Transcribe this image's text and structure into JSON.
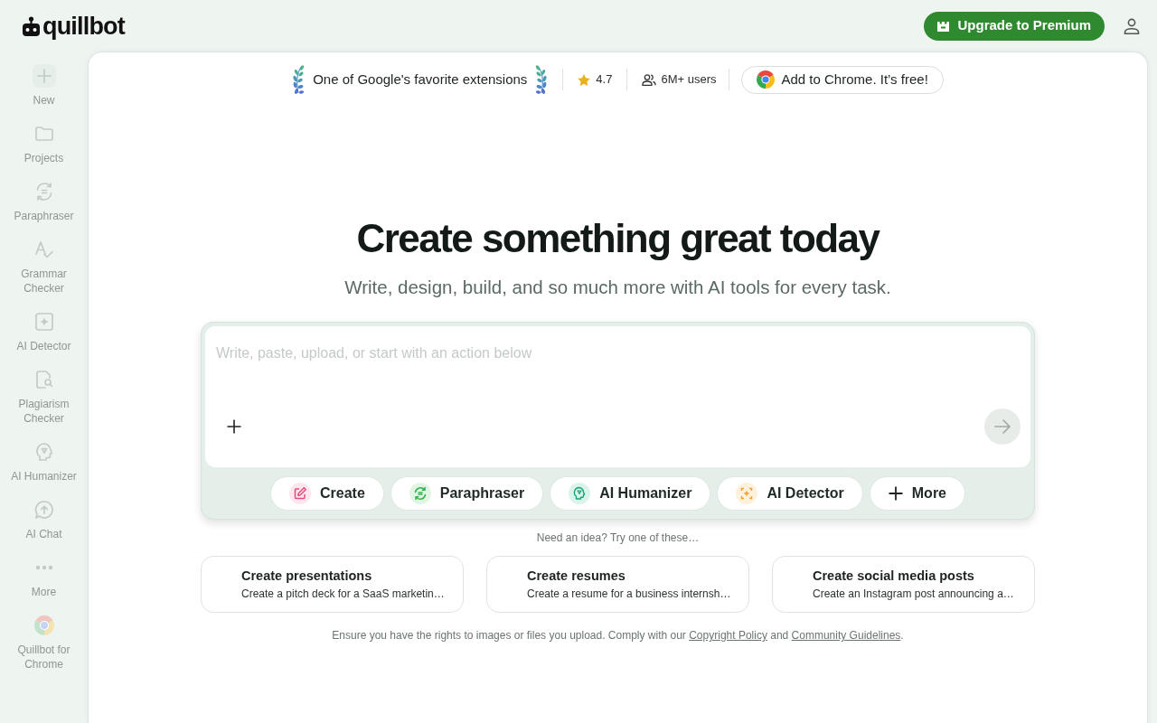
{
  "logo": {
    "text": "quillbot"
  },
  "header": {
    "upgrade_button": {
      "label": "Upgrade to Premium"
    }
  },
  "sidebar": {
    "items": [
      {
        "kind": "new",
        "label": "New"
      },
      {
        "kind": "projects",
        "label": "Projects"
      },
      {
        "kind": "paraphraser",
        "label": "Paraphraser"
      },
      {
        "kind": "grammar",
        "label": "Grammar Checker"
      },
      {
        "kind": "detector",
        "label": "AI Detector"
      },
      {
        "kind": "plagiarism",
        "label": "Plagiarism Checker"
      },
      {
        "kind": "humanizer",
        "label": "AI Humanizer"
      },
      {
        "kind": "chat",
        "label": "AI Chat"
      },
      {
        "kind": "more",
        "label": "More"
      },
      {
        "kind": "chrome",
        "label": "Quillbot for Chrome"
      }
    ]
  },
  "banner": {
    "award": "One of Google's favorite extensions",
    "rating": "4.7",
    "users": "6M+ users",
    "chrome_button": "Add to Chrome. It’s free!"
  },
  "hero": {
    "title": "Create something great today",
    "subtitle": "Write, design, build, and so much more with AI tools for every task."
  },
  "composer": {
    "placeholder": "Write, paste, upload, or start with an action below",
    "actions": [
      {
        "kind": "create",
        "label": "Create"
      },
      {
        "kind": "paraphraser",
        "label": "Paraphraser"
      },
      {
        "kind": "humanizer",
        "label": "AI Humanizer"
      },
      {
        "kind": "detector",
        "label": "AI Detector"
      },
      {
        "kind": "more",
        "label": "More"
      }
    ]
  },
  "suggestions": {
    "prompt": "Need an idea? Try one of these…",
    "cards": [
      {
        "title": "Create presentations",
        "description": "Create a pitch deck for a SaaS marketin…"
      },
      {
        "title": "Create resumes",
        "description": "Create a resume for a business internsh…"
      },
      {
        "title": "Create social media posts",
        "description": "Create an Instagram post announcing a…"
      }
    ]
  },
  "footer": {
    "parts": [
      {
        "kind": "text",
        "text": "Ensure you have the rights to images or files you upload. Comply with our "
      },
      {
        "kind": "link",
        "text": "Copyright Policy"
      },
      {
        "kind": "text",
        "text": " and "
      },
      {
        "kind": "link",
        "text": "Community Guidelines"
      },
      {
        "kind": "text",
        "text": "."
      }
    ]
  }
}
